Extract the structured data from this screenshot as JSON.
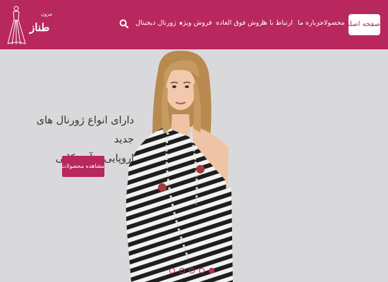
{
  "brand": {
    "name": "طناز",
    "tagline": "مزون"
  },
  "nav": {
    "home": "صفحه اصلی",
    "items": [
      {
        "label": "محصولات",
        "has_dropdown": true
      },
      {
        "label": "درباره ما"
      },
      {
        "label": "ارتباط با ما"
      },
      {
        "label": "فروش فوق العاده"
      },
      {
        "label": "فروش ویژه"
      },
      {
        "label": "ژورنال ديجيتال",
        "has_dropdown": true
      }
    ],
    "search_icon": "search-icon",
    "caret": "▾"
  },
  "hero": {
    "title_line1": "دارای انواع ژورنال های جدید",
    "title_line2": "اروپایی و آمریکایی",
    "button_label": "مشاهده محصولات",
    "slides": {
      "count": 5,
      "active_index": 4
    }
  },
  "colors": {
    "accent": "#b8275e",
    "background": "#d9d9db",
    "text": "#333333"
  }
}
